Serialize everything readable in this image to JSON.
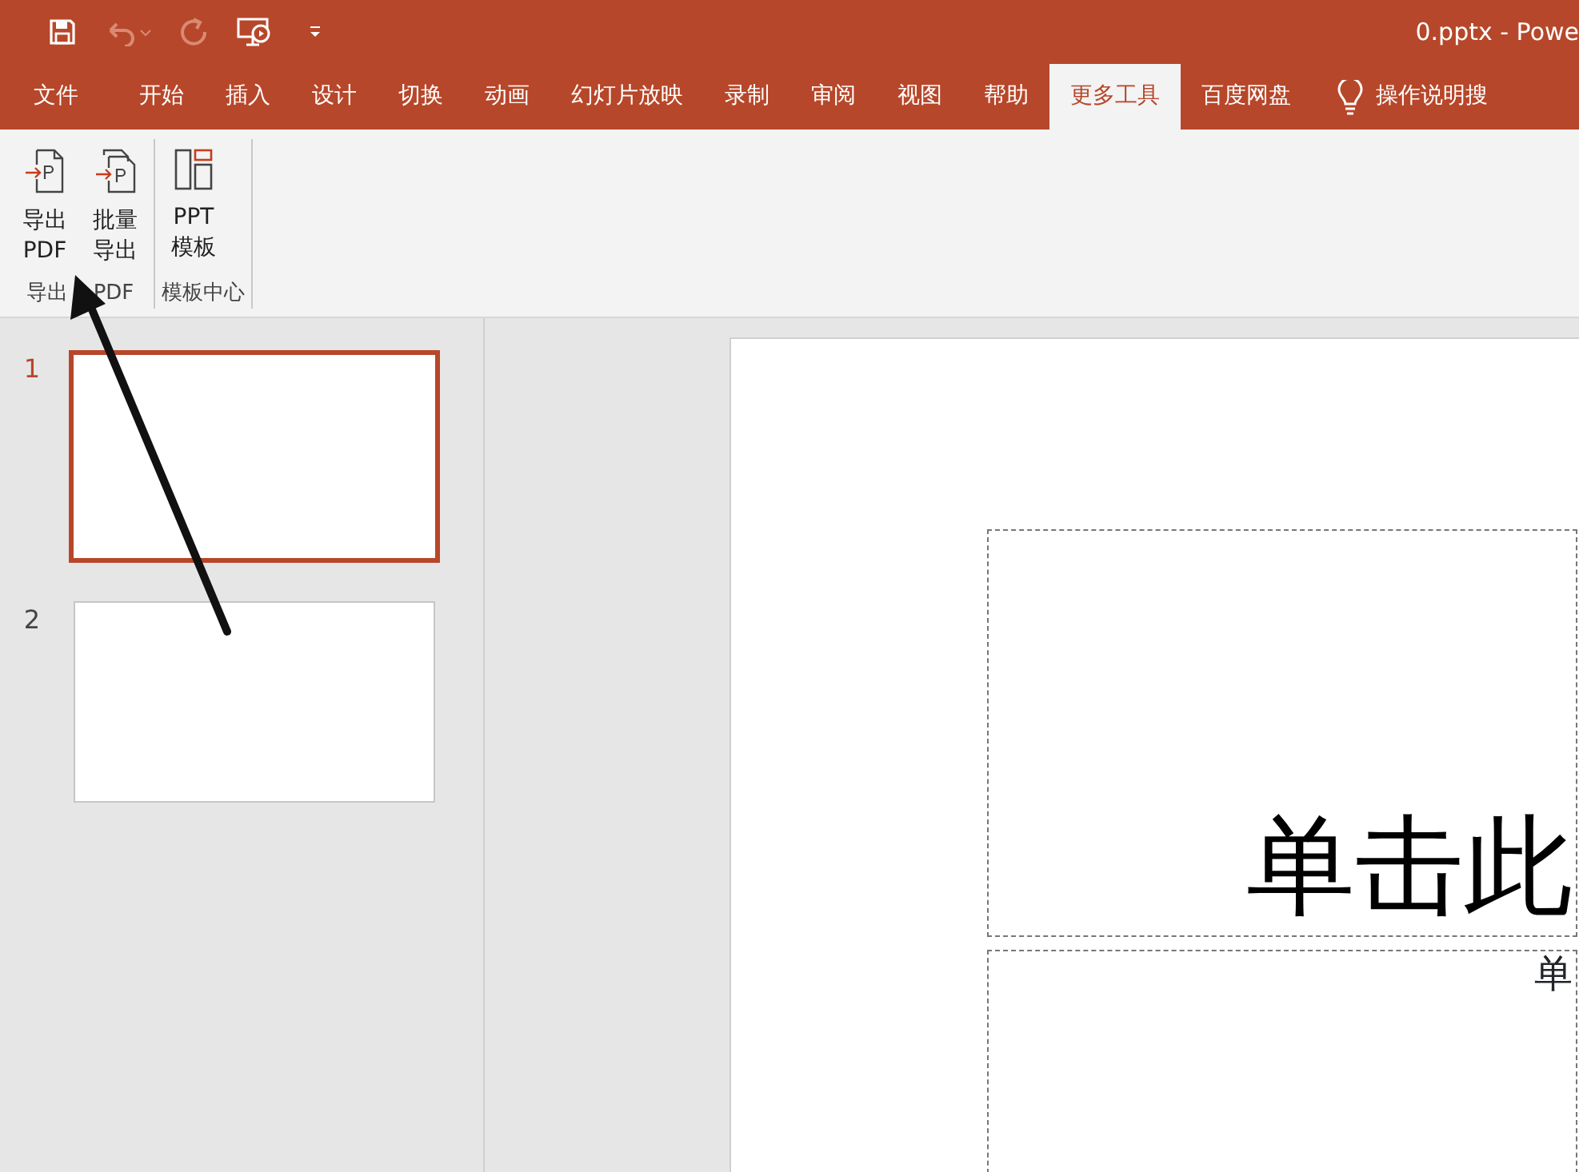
{
  "window": {
    "title": "0.pptx  -  Powe"
  },
  "quick_access": [
    {
      "kind": "save",
      "disabled": false
    },
    {
      "kind": "undo",
      "disabled": true
    },
    {
      "kind": "redo",
      "disabled": true
    },
    {
      "kind": "present",
      "disabled": false
    },
    {
      "kind": "customize",
      "disabled": false
    }
  ],
  "tabs": [
    {
      "label": "文件",
      "selected": false
    },
    {
      "label": "开始",
      "selected": false
    },
    {
      "label": "插入",
      "selected": false
    },
    {
      "label": "设计",
      "selected": false
    },
    {
      "label": "切换",
      "selected": false
    },
    {
      "label": "动画",
      "selected": false
    },
    {
      "label": "幻灯片放映",
      "selected": false
    },
    {
      "label": "录制",
      "selected": false
    },
    {
      "label": "审阅",
      "selected": false
    },
    {
      "label": "视图",
      "selected": false
    },
    {
      "label": "帮助",
      "selected": false
    },
    {
      "label": "更多工具",
      "selected": true
    },
    {
      "label": "百度网盘",
      "selected": false
    }
  ],
  "tell_me": {
    "label": "操作说明搜"
  },
  "ribbon_groups": [
    {
      "label_parts": [
        "导出",
        "PDF"
      ],
      "buttons": [
        {
          "kind": "export",
          "lines": [
            "导出",
            "PDF"
          ]
        },
        {
          "kind": "batch",
          "lines": [
            "批量",
            "导出"
          ]
        }
      ]
    },
    {
      "label": "模板中心",
      "buttons": [
        {
          "kind": "template",
          "lines": [
            "PPT",
            "模板"
          ]
        }
      ]
    }
  ],
  "slides": [
    {
      "number": "1",
      "selected": true
    },
    {
      "number": "2",
      "selected": false
    }
  ],
  "slide": {
    "title_placeholder": "单击此",
    "subtitle_placeholder": "单"
  }
}
